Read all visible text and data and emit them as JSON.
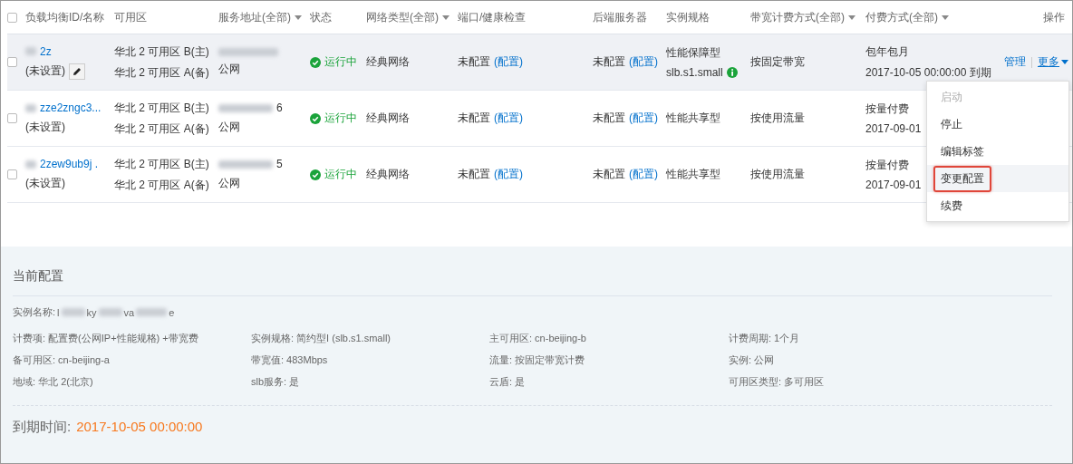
{
  "table": {
    "select_all": {
      "checked": false
    },
    "columns": [
      {
        "label": "负载均衡ID/名称",
        "dropdown": false
      },
      {
        "label": "可用区",
        "dropdown": false
      },
      {
        "label": "服务地址(全部)",
        "dropdown": true
      },
      {
        "label": "状态",
        "dropdown": false
      },
      {
        "label": "网络类型(全部)",
        "dropdown": true
      },
      {
        "label": "端口/健康检查",
        "dropdown": false
      },
      {
        "label": "后端服务器",
        "dropdown": false
      },
      {
        "label": "实例规格",
        "dropdown": false
      },
      {
        "label": "带宽计费方式(全部)",
        "dropdown": true
      },
      {
        "label": "付费方式(全部)",
        "dropdown": true
      },
      {
        "label": "操作",
        "dropdown": false
      }
    ],
    "rows": [
      {
        "checked": false,
        "hovered": true,
        "id": "2z",
        "name": "(未设置)",
        "editable": true,
        "zones": [
          "华北 2 可用区 B(主)",
          "华北 2 可用区 A(备)"
        ],
        "address_tail": "",
        "address_type": "公网",
        "status": "运行中",
        "network": "经典网络",
        "port_check": "未配置",
        "port_link": "(配置)",
        "backend": "未配置",
        "backend_link": "(配置)",
        "spec": [
          "性能保障型",
          "slb.s1.small"
        ],
        "spec_info": true,
        "bandwidth": "按固定带宽",
        "pay": [
          "包年包月",
          "2017-10-05 00:00:00 到期"
        ],
        "actions": [
          "管理",
          "更多"
        ]
      },
      {
        "checked": false,
        "hovered": false,
        "id": "zze2zngc3...",
        "name": "(未设置)",
        "editable": false,
        "zones": [
          "华北 2 可用区 B(主)",
          "华北 2 可用区 A(备)"
        ],
        "address_tail": "6",
        "address_type": "公网",
        "status": "运行中",
        "network": "经典网络",
        "port_check": "未配置",
        "port_link": "(配置)",
        "backend": "未配置",
        "backend_link": "(配置)",
        "spec": [
          "性能共享型"
        ],
        "spec_info": false,
        "bandwidth": "按使用流量",
        "pay": [
          "按量付费",
          "2017-09-01"
        ]
      },
      {
        "checked": false,
        "hovered": false,
        "id": "2zew9ub9j .",
        "name": "(未设置)",
        "editable": false,
        "zones": [
          "华北 2 可用区 B(主)",
          "华北 2 可用区 A(备)"
        ],
        "address_tail": "5",
        "address_type": "公网",
        "status": "运行中",
        "network": "经典网络",
        "port_check": "未配置",
        "port_link": "(配置)",
        "backend": "未配置",
        "backend_link": "(配置)",
        "spec": [
          "性能共享型"
        ],
        "spec_info": false,
        "bandwidth": "按使用流量",
        "pay": [
          "按量付费",
          "2017-09-01"
        ]
      }
    ]
  },
  "more_menu": {
    "items": [
      {
        "label": "启动",
        "disabled": true,
        "selected": false
      },
      {
        "label": "停止",
        "disabled": false,
        "selected": false
      },
      {
        "label": "编辑标签",
        "disabled": false,
        "selected": false
      },
      {
        "label": "变更配置",
        "disabled": false,
        "selected": true
      },
      {
        "label": "续费",
        "disabled": false,
        "selected": false
      }
    ]
  },
  "config": {
    "title": "当前配置",
    "instance_name_label": "实例名称:",
    "instance_name_parts": [
      "l",
      "ky",
      "va",
      "e"
    ],
    "fields": [
      "计费项: 配置费(公网IP+性能规格) +带宽费",
      "实例规格: 简约型I (slb.s1.small)",
      "主可用区: cn-beijing-b",
      "计费周期: 1个月",
      "备可用区: cn-beijing-a",
      "带宽值: 483Mbps",
      "流量: 按固定带宽计费",
      "实例: 公网",
      "地域: 华北 2(北京)",
      "slb服务: 是",
      "云盾: 是",
      "可用区类型: 多可用区"
    ],
    "expiry_label": "到期时间:",
    "expiry_value": "2017-10-05 00:00:00"
  }
}
